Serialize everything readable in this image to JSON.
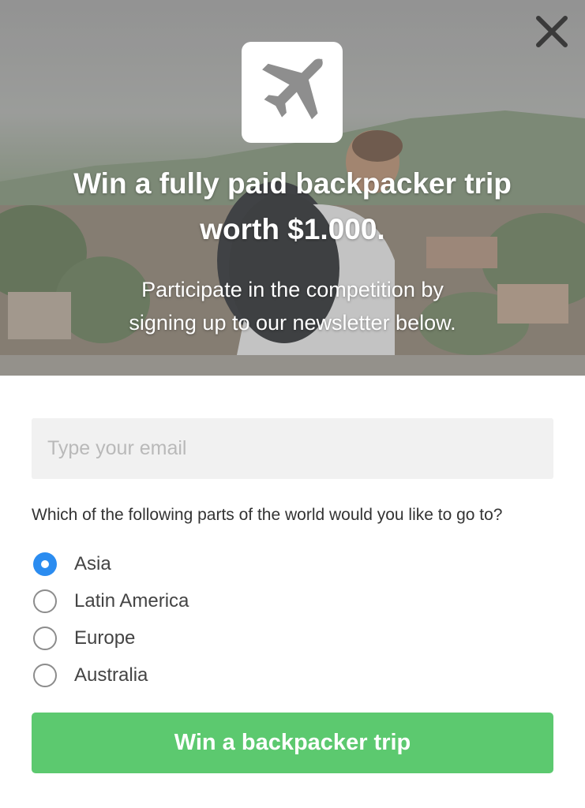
{
  "popup": {
    "close_icon": "close-icon",
    "logo_icon": "airplane-icon",
    "title": "Win a fully paid backpacker trip\nworth $1.000.",
    "subtitle": "Participate in the competition by\nsigning up to our newsletter below."
  },
  "form": {
    "email_placeholder": "Type your email",
    "email_value": "",
    "question": "Which of the following parts of the world would you like to go to?",
    "options": [
      {
        "label": "Asia",
        "selected": true
      },
      {
        "label": "Latin America",
        "selected": false
      },
      {
        "label": "Europe",
        "selected": false
      },
      {
        "label": "Australia",
        "selected": false
      }
    ],
    "submit_label": "Win a backpacker trip"
  },
  "colors": {
    "accent_radio": "#2b8cf0",
    "button_green": "#5cc96f",
    "input_bg": "#f1f1f1"
  }
}
